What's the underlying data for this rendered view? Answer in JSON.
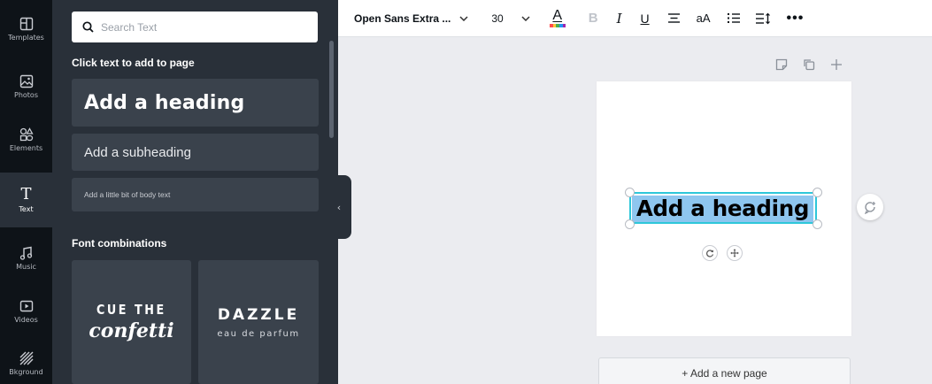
{
  "rail": {
    "items": [
      {
        "label": "Templates",
        "icon": "templates-icon"
      },
      {
        "label": "Photos",
        "icon": "photos-icon"
      },
      {
        "label": "Elements",
        "icon": "elements-icon"
      },
      {
        "label": "Text",
        "icon": "text-icon",
        "active": true
      },
      {
        "label": "Music",
        "icon": "music-icon"
      },
      {
        "label": "Videos",
        "icon": "videos-icon"
      },
      {
        "label": "Bkground",
        "icon": "background-icon"
      }
    ]
  },
  "panel": {
    "search_placeholder": "Search Text",
    "click_text_title": "Click text to add to page",
    "heading_label": "Add a heading",
    "subheading_label": "Add a subheading",
    "body_label": "Add a little bit of body text",
    "font_combinations_title": "Font combinations",
    "combos": [
      {
        "top": "CUE THE",
        "bottom": "confetti"
      },
      {
        "top": "DAZZLE",
        "bottom": "eau de parfum"
      }
    ]
  },
  "toolbar": {
    "font_name": "Open Sans Extra ...",
    "font_size": "30",
    "text_color_label": "A",
    "bold_label": "B",
    "italic_label": "I",
    "underline_label": "U",
    "case_label": "aA",
    "more_label": "•••",
    "text_color": "#0e1318",
    "color_bar": [
      "#ff4d4d",
      "#ffc53d",
      "#4caf50",
      "#2196f3",
      "#9c27b0"
    ]
  },
  "canvas": {
    "selected_text": "Add a heading",
    "add_page_label": "+ Add a new page",
    "selection_color": "#2ec7d9",
    "highlight_color": "#8ec6ef"
  }
}
